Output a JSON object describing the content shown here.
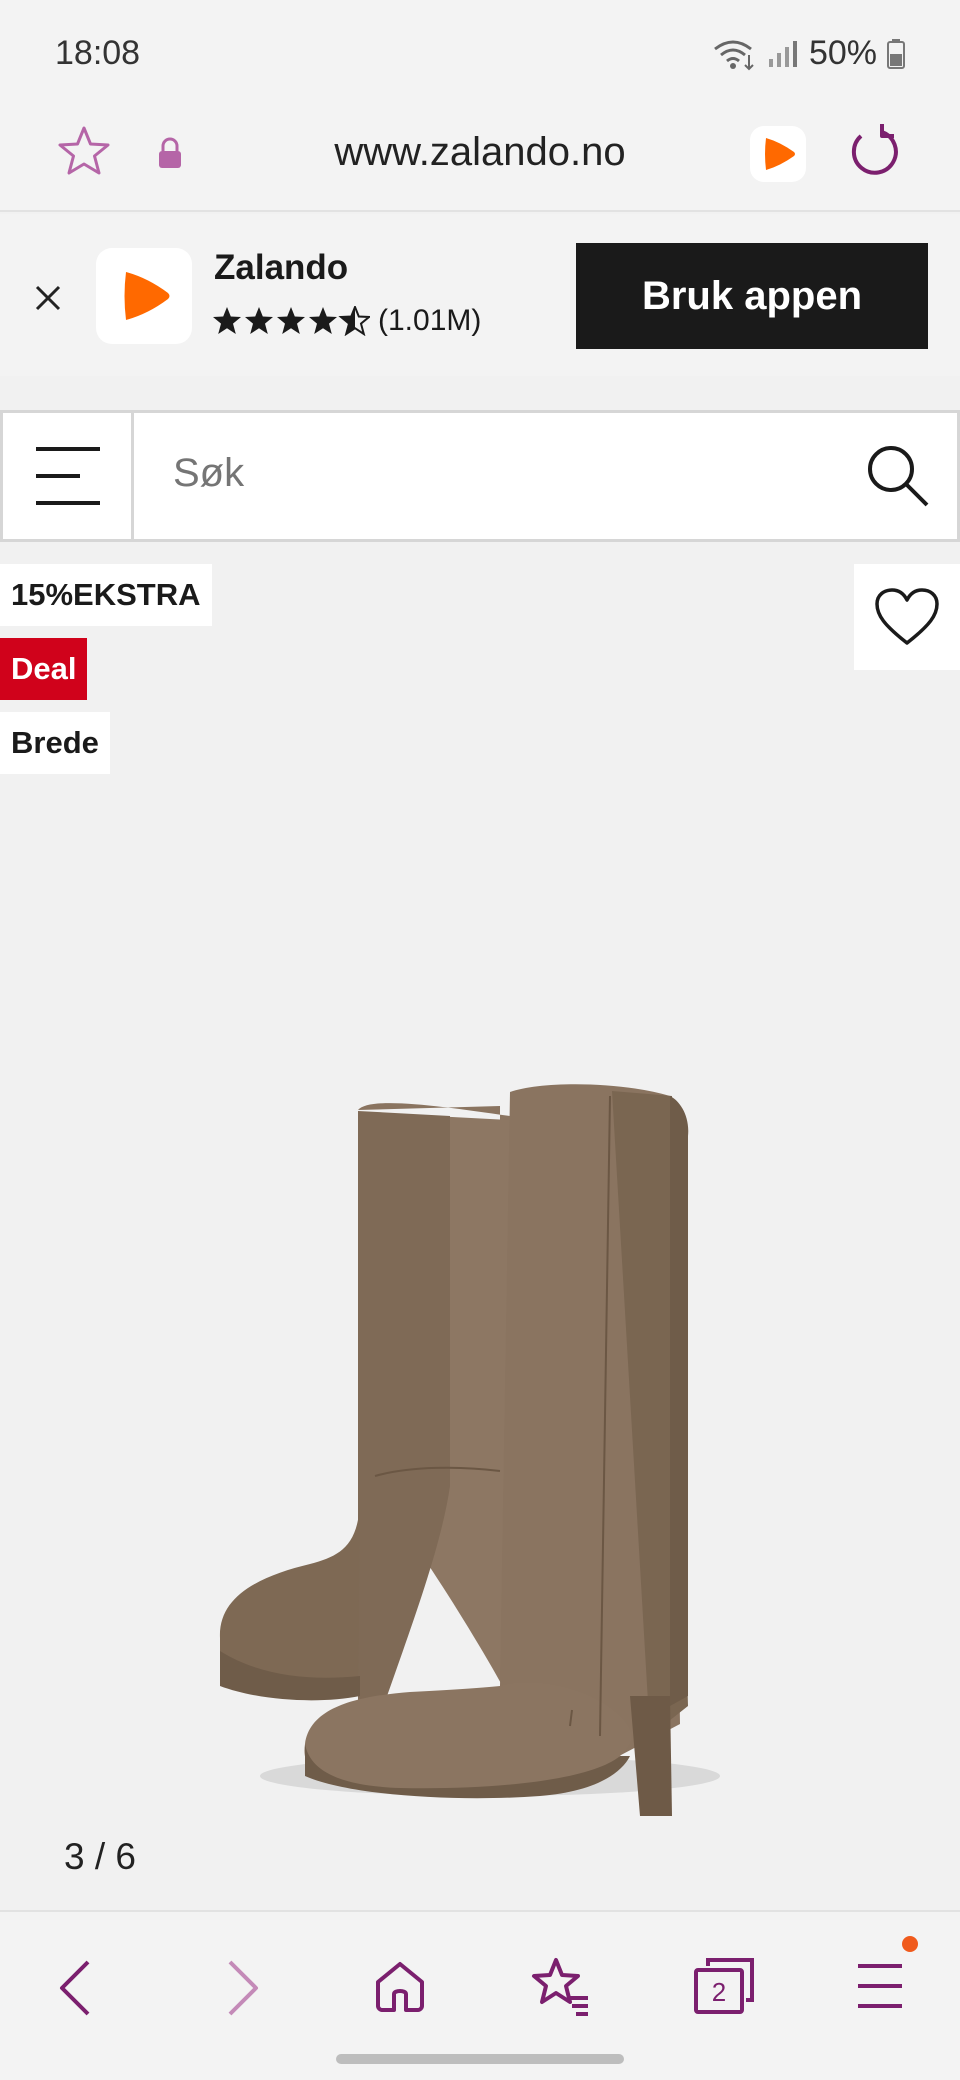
{
  "status_bar": {
    "time": "18:08",
    "battery": "50%"
  },
  "browser": {
    "url": "www.zalando.no",
    "tab_count": "2"
  },
  "app_banner": {
    "app_name": "Zalando",
    "rating_count": "(1.01M)",
    "rating_stars": 4.5,
    "cta_label": "Bruk appen"
  },
  "search": {
    "placeholder": "Søk"
  },
  "product": {
    "badges": [
      "15%EKSTRA",
      "Deal",
      "Brede"
    ],
    "image_counter": "3 / 6"
  },
  "colors": {
    "brand_orange": "#ff6900",
    "deal_red": "#d0021b",
    "browser_purple": "#7b1f6e"
  },
  "icons": {
    "bookmark": "star-outline-icon",
    "lock": "lock-icon",
    "reload": "reload-icon",
    "close": "close-icon",
    "menu": "hamburger-icon",
    "search": "search-icon",
    "favorite": "heart-icon"
  }
}
